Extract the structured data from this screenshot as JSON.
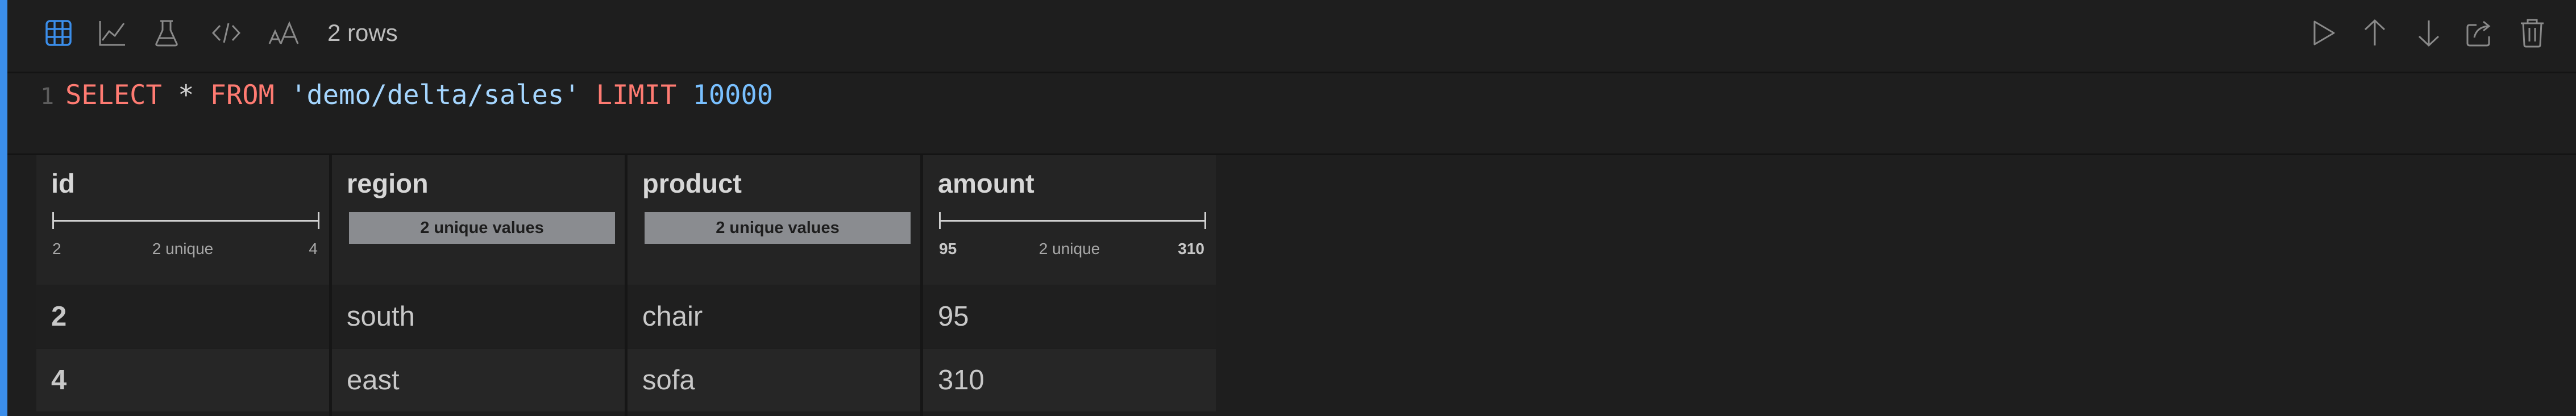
{
  "toolbar": {
    "row_count": "2 rows",
    "left_icons": [
      "table-view-icon",
      "chart-view-icon",
      "flask-icon",
      "code-icon",
      "text-size-icon"
    ],
    "right_icons": [
      "run-icon",
      "move-up-icon",
      "move-down-icon",
      "share-icon",
      "trash-icon"
    ],
    "accent_color": "#3b8eea"
  },
  "editor": {
    "line_number": "1",
    "tokens": {
      "select": "SELECT",
      "star": " * ",
      "from": "FROM",
      "space1": " ",
      "path": "'demo/delta/sales'",
      "space2": " ",
      "limit": "LIMIT",
      "space3": " ",
      "limit_value": "10000"
    },
    "colors": {
      "keyword": "#ff7b72",
      "string": "#a5d6ff",
      "number": "#79c0ff"
    }
  },
  "table": {
    "columns": [
      {
        "name": "id",
        "summary": {
          "kind": "range",
          "min": "2",
          "max": "4",
          "unique": "2 unique"
        }
      },
      {
        "name": "region",
        "summary": {
          "kind": "categorical",
          "label": "2 unique values"
        }
      },
      {
        "name": "product",
        "summary": {
          "kind": "categorical",
          "label": "2 unique values"
        }
      },
      {
        "name": "amount",
        "summary": {
          "kind": "range",
          "min": "95",
          "max": "310",
          "unique": "2 unique"
        }
      }
    ],
    "rows": [
      [
        "2",
        "south",
        "chair",
        "95"
      ],
      [
        "4",
        "east",
        "sofa",
        "310"
      ]
    ]
  }
}
